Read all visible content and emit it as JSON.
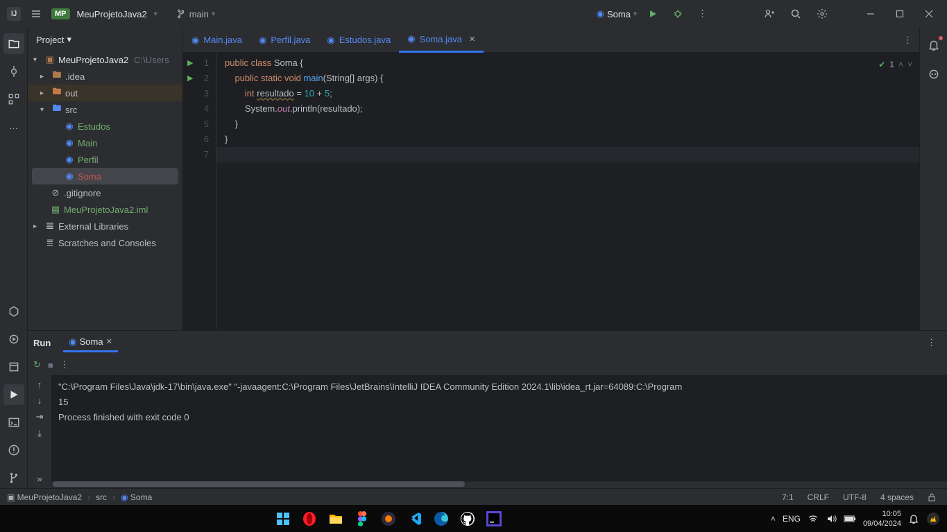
{
  "titlebar": {
    "project_badge": "MP",
    "project_name": "MeuProjetoJava2",
    "branch": "main",
    "run_config": "Soma"
  },
  "project_panel": {
    "title": "Project",
    "root": "MeuProjetoJava2",
    "root_path": "C:\\Users",
    "idea": ".idea",
    "out": "out",
    "src": "src",
    "files": {
      "estudos": "Estudos",
      "main": "Main",
      "perfil": "Perfil",
      "soma": "Soma"
    },
    "gitignore": ".gitignore",
    "iml": "MeuProjetoJava2.iml",
    "external": "External Libraries",
    "scratches": "Scratches and Consoles"
  },
  "tabs": {
    "main": "Main.java",
    "perfil": "Perfil.java",
    "estudos": "Estudos.java",
    "soma": "Soma.java"
  },
  "editor": {
    "inspection_count": "1",
    "code": {
      "class_name": "Soma",
      "method": "main",
      "args": "(String[] args)",
      "var_type": "int",
      "var_name": "resultado",
      "val1": "10",
      "op": "+",
      "val2": "5",
      "out_obj": "System",
      "out_field": "out",
      "println": ".println(resultado);"
    }
  },
  "run": {
    "label": "Run",
    "tab": "Soma",
    "console_line1": "\"C:\\Program Files\\Java\\jdk-17\\bin\\java.exe\" \"-javaagent:C:\\Program Files\\JetBrains\\IntelliJ IDEA Community Edition 2024.1\\lib\\idea_rt.jar=64089:C:\\Program",
    "console_line2": "15",
    "console_line3": "",
    "console_line4": "Process finished with exit code 0"
  },
  "statusbar": {
    "bc1": "MeuProjetoJava2",
    "bc2": "src",
    "bc3": "Soma",
    "pos": "7:1",
    "eol": "CRLF",
    "enc": "UTF-8",
    "indent": "4 spaces"
  },
  "taskbar": {
    "lang": "ENG",
    "time": "10:05",
    "date": "09/04/2024"
  }
}
